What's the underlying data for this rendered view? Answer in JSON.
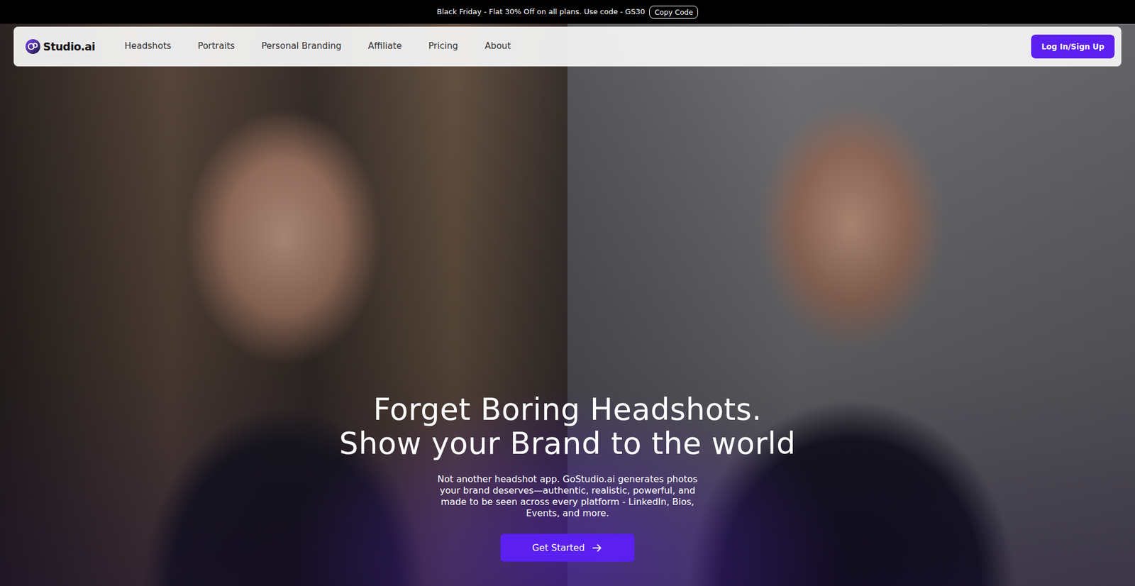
{
  "announcement": {
    "text": "Black Friday - Flat 30% Off on all plans. Use code - GS30",
    "button": "Copy Code"
  },
  "logo": {
    "text": "Studio.ai"
  },
  "nav": {
    "items": [
      "Headshots",
      "Portraits",
      "Personal Branding",
      "Affiliate",
      "Pricing",
      "About"
    ]
  },
  "login_button": "Log In/Sign Up",
  "hero": {
    "title_lines": [
      "Forget Boring Headshots.",
      "Show your Brand to the world"
    ],
    "description": "Not another headshot app. GoStudio.ai generates photos your brand deserves—authentic, realistic, powerful, and made to be seen across every platform - LinkedIn, Bios, Events, and more.",
    "cta": "Get Started"
  }
}
